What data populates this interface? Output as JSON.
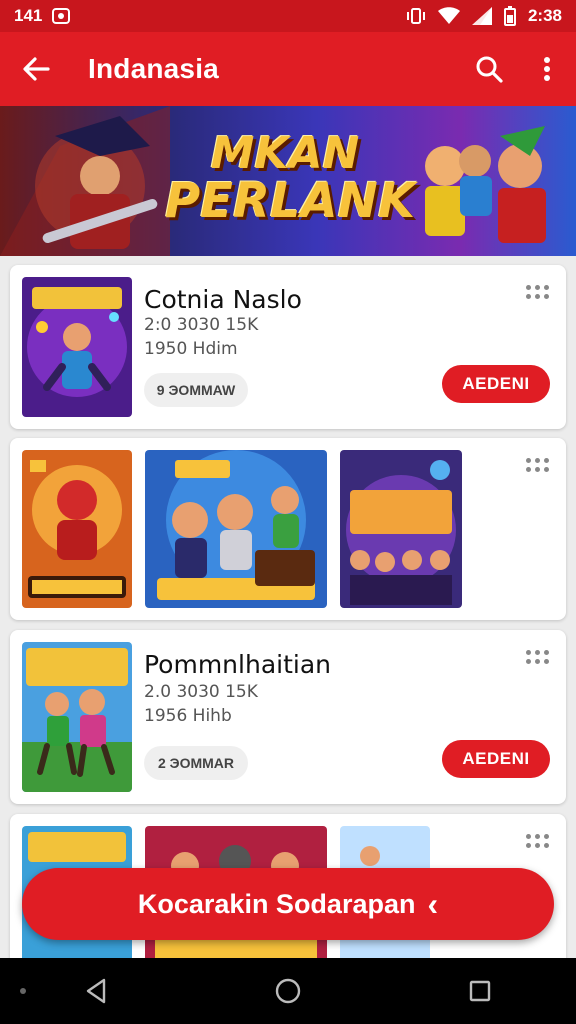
{
  "status_bar": {
    "time_left": "141",
    "time_right": "2:38"
  },
  "app_bar": {
    "title": "Indanasia"
  },
  "banner": {
    "title_line1": "MKAN",
    "title_line2": "PERLANK"
  },
  "cards": [
    {
      "name": "Cotnia Naslo",
      "meta1": "2:0 3030 15K",
      "meta2": "1950 Hdim",
      "chip": "9 ЭOMMAW",
      "install": "AEDENI"
    },
    {
      "name": "",
      "meta1": "",
      "meta2": "",
      "chip": "",
      "install": ""
    },
    {
      "name": "Pommnlhaitian",
      "meta1": "2.0 3030 15K",
      "meta2": "1956 Hihb",
      "chip": "2 ЭOMMAR",
      "install": "AEDENI"
    },
    {
      "name": "",
      "meta1": "",
      "meta2": "",
      "chip": "",
      "install": ""
    }
  ],
  "cta": {
    "label": "Kocarakin Sodarapan",
    "chevron": "‹"
  },
  "colors": {
    "primary_red": "#e01d24",
    "status_red": "#c8161d",
    "background": "#ececec"
  },
  "icons": [
    "back-arrow-icon",
    "search-icon",
    "more-vert-icon",
    "more-dots-icon",
    "nav-back-icon",
    "nav-home-icon",
    "nav-recents-icon"
  ]
}
